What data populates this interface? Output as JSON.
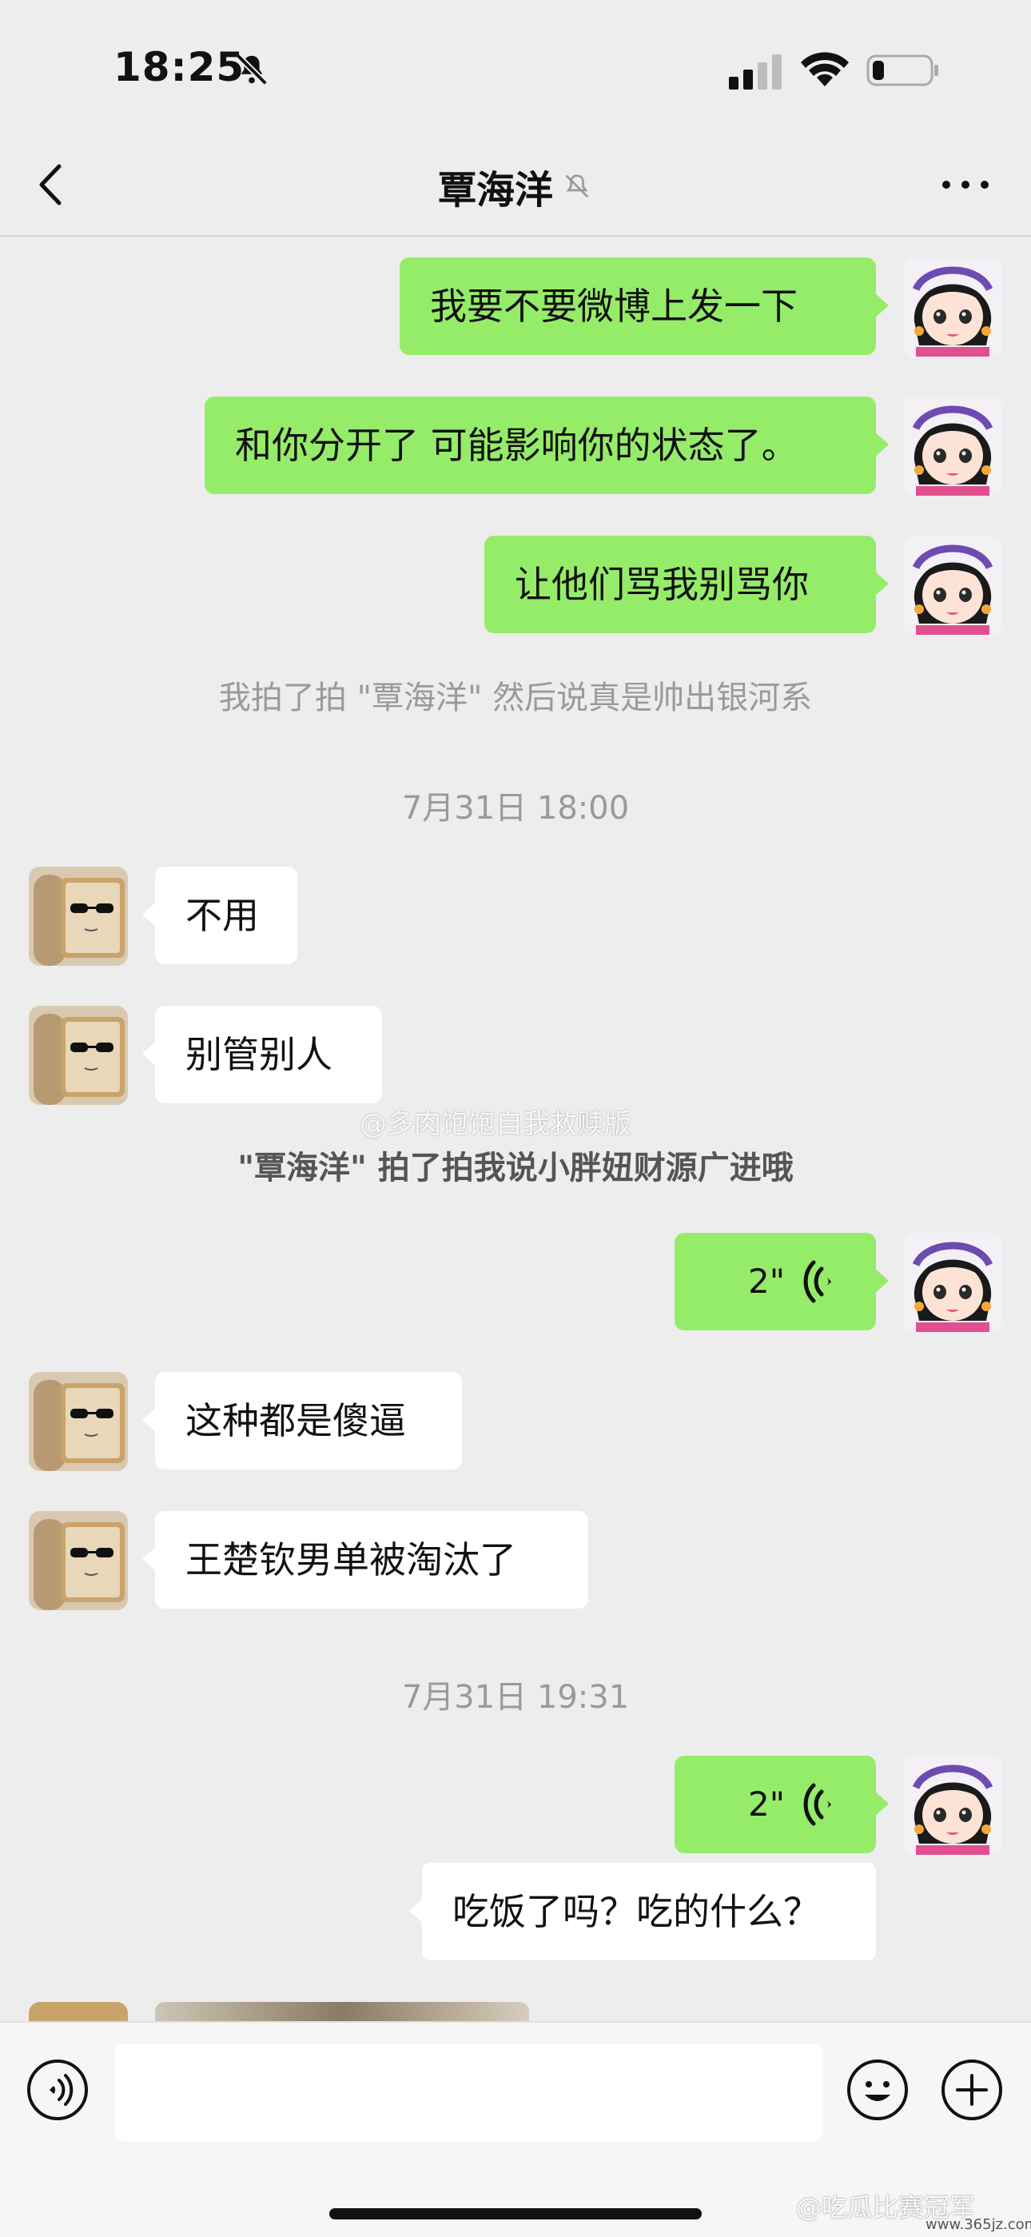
{
  "status": {
    "time": "18:25"
  },
  "nav": {
    "title": "覃海洋"
  },
  "messages": {
    "m1": "我要不要微博上发一下",
    "m2": "和你分开了 可能影响你的状态了。",
    "m3": "让他们骂我别骂你",
    "sys1": "我拍了拍 \"覃海洋\" 然后说真是帅出银河系",
    "time1": "7月31日 18:00",
    "t1": "不用",
    "t2": "别管别人",
    "sys2": "\"覃海洋\" 拍了拍我说小胖妞财源广进哦",
    "voice1": "2\"",
    "t3": "这种都是傻逼",
    "t4": "王楚钦男单被淘汰了",
    "time2": "7月31日 19:31",
    "voice2": "2\"",
    "m4": "吃饭了吗？吃的什么？"
  },
  "watermarks": {
    "center": "@多肉饱饱自我救赎版",
    "bottom": "@吃瓜比赛冠军",
    "site": "www.365jz.com"
  },
  "colors": {
    "background": "#ededed",
    "mine_bubble": "#95ec69",
    "theirs_bubble": "#ffffff"
  },
  "icons": [
    "bell-slash-icon",
    "signal-icon",
    "wifi-icon",
    "battery-icon",
    "back-chevron-icon",
    "more-dots-icon",
    "voice-wave-icon",
    "voice-input-icon",
    "emoji-icon",
    "plus-icon"
  ]
}
